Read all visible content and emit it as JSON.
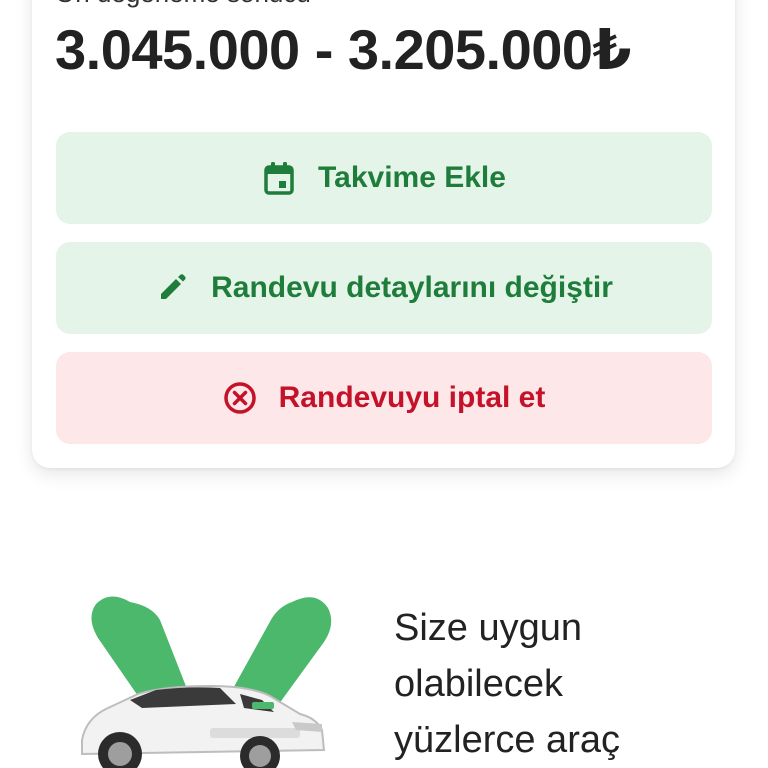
{
  "valuation": {
    "label": "Ön değerleme sonucu",
    "price_range": "3.045.000 - 3.205.000₺"
  },
  "actions": {
    "add_calendar": "Takvime Ekle",
    "edit_details": "Randevu detaylarını değiştir",
    "cancel": "Randevuyu iptal et"
  },
  "promo": {
    "line1": "Size uygun",
    "line2": "olabilecek",
    "line3": "yüzlerce araç"
  },
  "colors": {
    "green_text": "#1e7d3a",
    "green_bg": "#e4f4e8",
    "red_text": "#c4122a",
    "red_bg": "#fde7e9",
    "brand_green": "#4cb86b"
  },
  "icons": {
    "calendar": "calendar-icon",
    "edit": "pencil-icon",
    "cancel": "close-circle-icon"
  }
}
